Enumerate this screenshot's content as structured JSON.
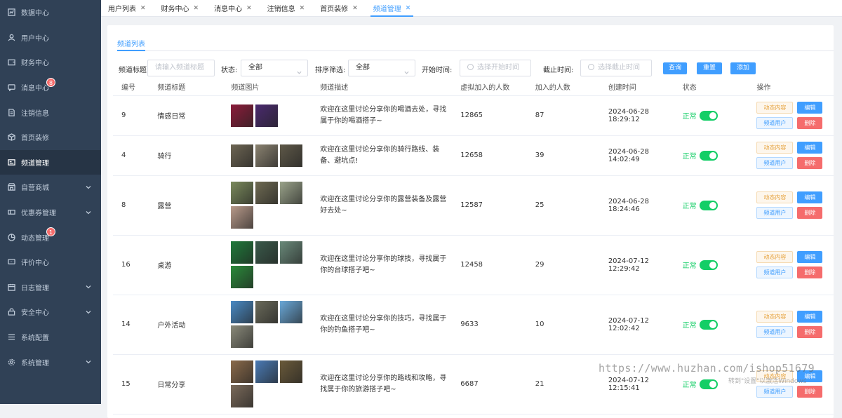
{
  "sidebar": {
    "items": [
      {
        "label": "数据中心",
        "icon": "chart-icon",
        "expandable": false
      },
      {
        "label": "用户中心",
        "icon": "user-icon",
        "expandable": false
      },
      {
        "label": "财务中心",
        "icon": "wallet-icon",
        "expandable": false
      },
      {
        "label": "消息中心",
        "icon": "message-icon",
        "expandable": false,
        "badge": "8"
      },
      {
        "label": "注销信息",
        "icon": "document-icon",
        "expandable": false
      },
      {
        "label": "首页装修",
        "icon": "box-icon",
        "expandable": false
      },
      {
        "label": "频道管理",
        "icon": "channel-icon",
        "expandable": false,
        "active": true
      },
      {
        "label": "自营商城",
        "icon": "shop-icon",
        "expandable": true
      },
      {
        "label": "优惠券管理",
        "icon": "coupon-icon",
        "expandable": true
      },
      {
        "label": "动态管理",
        "icon": "pie-icon",
        "expandable": false,
        "badge": "1"
      },
      {
        "label": "评价中心",
        "icon": "comment-icon",
        "expandable": false
      },
      {
        "label": "日志管理",
        "icon": "calendar-icon",
        "expandable": true
      },
      {
        "label": "安全中心",
        "icon": "lock-icon",
        "expandable": true
      },
      {
        "label": "系统配置",
        "icon": "list-icon",
        "expandable": false
      },
      {
        "label": "系统管理",
        "icon": "gear-icon",
        "expandable": true
      }
    ]
  },
  "tabs": [
    {
      "label": "用户列表",
      "active": false
    },
    {
      "label": "财务中心",
      "active": false
    },
    {
      "label": "消息中心",
      "active": false
    },
    {
      "label": "注销信息",
      "active": false
    },
    {
      "label": "首页装修",
      "active": false
    },
    {
      "label": "频道管理",
      "active": true
    }
  ],
  "subtab": "频道列表",
  "filters": {
    "title_label": "频道标题:",
    "title_placeholder": "请输入频道标题",
    "status_label": "状态:",
    "status_value": "全部",
    "sort_label": "排序筛选:",
    "sort_value": "全部",
    "start_label": "开始时间:",
    "start_placeholder": "选择开始时间",
    "end_label": "截止时间:",
    "end_placeholder": "选择截止时间",
    "query_btn": "查询",
    "reset_btn": "重置",
    "add_btn": "添加"
  },
  "table": {
    "headers": [
      "编号",
      "频道标题",
      "频道图片",
      "频道描述",
      "虚拟加入的人数",
      "加入的人数",
      "创建时间",
      "状态",
      "操作"
    ],
    "rows": [
      {
        "id": "9",
        "title": "情感日常",
        "images": [
          "#8b1c3a",
          "#4a2a6e"
        ],
        "desc": "欢迎在这里讨论分享你的喝酒去处，寻找属于你的喝酒搭子~",
        "virtual": "12865",
        "joined": "87",
        "created": "2024-06-28 18:29:12",
        "status": "正常"
      },
      {
        "id": "4",
        "title": "骑行",
        "images": [
          "#6d6553",
          "#8a8270",
          "#5e5848"
        ],
        "desc": "欢迎在这里讨论分享你的骑行路线、装备、避坑点!",
        "virtual": "12658",
        "joined": "39",
        "created": "2024-06-28 14:02:49",
        "status": "正常"
      },
      {
        "id": "8",
        "title": "露营",
        "images": [
          "#7b8a5c",
          "#6e6a52",
          "#9aa38a",
          "#b89a8a"
        ],
        "desc": "欢迎在这里讨论分享你的露营装备及露营好去处~",
        "virtual": "12587",
        "joined": "25",
        "created": "2024-06-28 18:24:46",
        "status": "正常"
      },
      {
        "id": "16",
        "title": "桌游",
        "images": [
          "#1f7a3a",
          "#3a5a4a",
          "#6a8a7a",
          "#2a8a3a"
        ],
        "desc": "欢迎在这里讨论分享你的球技，寻找属于你的台球搭子吧~",
        "virtual": "12458",
        "joined": "29",
        "created": "2024-07-12 12:29:42",
        "status": "正常"
      },
      {
        "id": "14",
        "title": "户外活动",
        "images": [
          "#4a8ac4",
          "#6a6a5a",
          "#6aa8d8",
          "#8a8a7a"
        ],
        "desc": "欢迎在这里讨论分享你的技巧，寻找属于你的钓鱼搭子吧~",
        "virtual": "9633",
        "joined": "10",
        "created": "2024-07-12 12:02:42",
        "status": "正常"
      },
      {
        "id": "15",
        "title": "日常分享",
        "images": [
          "#8a6a4a",
          "#4a7ab4",
          "#6a5a3a",
          "#7a6a5a"
        ],
        "desc": "欢迎在这里讨论分享你的路线和攻略，寻找属于你的旅游搭子吧~",
        "virtual": "6687",
        "joined": "21",
        "created": "2024-07-12 12:15:41",
        "status": "正常"
      }
    ],
    "op_labels": {
      "content": "动态内容",
      "edit": "编辑",
      "users": "频道用户",
      "delete": "删除"
    }
  },
  "watermark": {
    "url": "https://www.huzhan.com/ishop51679",
    "sub": "转到\"设置\"以激活Windows"
  },
  "colors": {
    "sidebar": "#304156",
    "accent": "#409eff",
    "success": "#13ce66",
    "danger": "#f56c6c",
    "warning": "#e6a23c"
  }
}
